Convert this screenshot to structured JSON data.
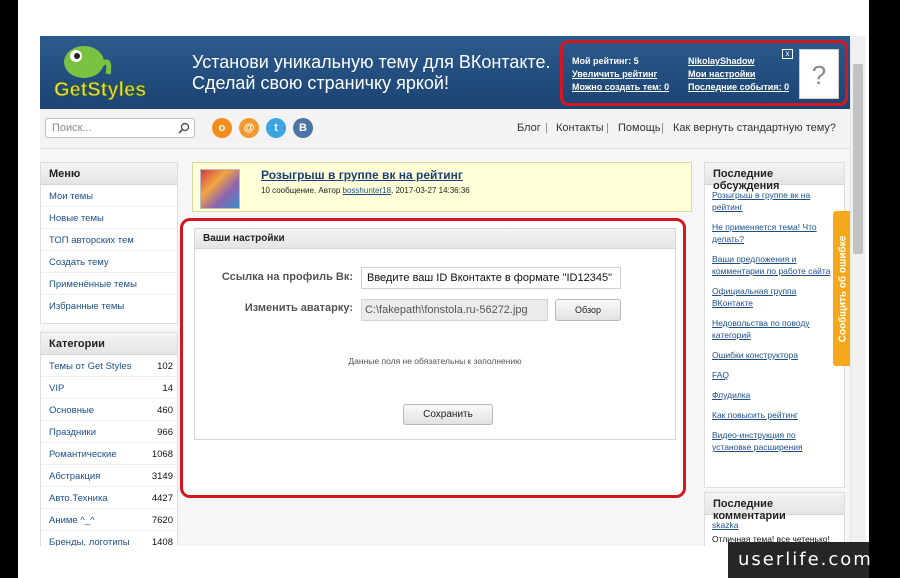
{
  "header": {
    "logo_text": "GetStyles",
    "slogan_line1": "Установи уникальную тему для ВКонтакте.",
    "slogan_line2": "Сделай свою страничку яркой!",
    "rating": "Мой рейтинг: 5",
    "increase_rating": "Увеличить рейтинг",
    "can_create": "Можно создать тем: 0",
    "username": "NikolayShadow",
    "my_settings": "Мои настройки",
    "recent_events": "Последние события: 0",
    "close": "[x]",
    "avatar_placeholder": "?"
  },
  "toolbar": {
    "search_placeholder": "Поиск...",
    "social": [
      "ok-icon",
      "mail-icon",
      "twitter-icon",
      "vk-icon"
    ],
    "nav": [
      "Блог",
      "Контакты",
      "Помощь",
      "Как вернуть стандартную тему?"
    ]
  },
  "menu": {
    "title": "Меню",
    "items": [
      "Мои темы",
      "Новые темы",
      "ТОП авторских тем",
      "Создать тему",
      "Применённые темы",
      "Избранные темы"
    ]
  },
  "categories": {
    "title": "Категории",
    "items": [
      {
        "label": "Темы от Get Styles",
        "count": "102"
      },
      {
        "label": "VIP",
        "count": "14"
      },
      {
        "label": "Основные",
        "count": "460"
      },
      {
        "label": "Праздники",
        "count": "966"
      },
      {
        "label": "Романтические",
        "count": "1068"
      },
      {
        "label": "Абстракция",
        "count": "3149"
      },
      {
        "label": "Авто.Техника",
        "count": "4427"
      },
      {
        "label": "Аниме ^_^",
        "count": "7620"
      },
      {
        "label": "Бренды, логотипы",
        "count": "1408"
      }
    ]
  },
  "contest": {
    "title": "Розыгрыш в группе вк на рейтинг",
    "meta_prefix": "10 сообщение. Автор",
    "author": "bosshunter18",
    "date": "2017-03-27 14:36:36"
  },
  "settings": {
    "title": "Ваши настройки",
    "vk_label": "Ссылка на профиль Вк:",
    "vk_value": "Введите ваш ID Вконтакте в формате \"ID12345\"",
    "avatar_label": "Изменить аватарку:",
    "file_value": "C:\\fakepath\\fonstola.ru-56272.jpg",
    "browse": "Обзор",
    "hint": "Данные поля не обязательны к заполнению",
    "save": "Сохранить"
  },
  "discussions": {
    "title": "Последние обсуждения",
    "items": [
      "Розыгрыш в группе вк на рейтинг",
      "Не применяется тема! Что делать?",
      "Ваши предложения и комментарии по работе сайта",
      "Официальная группа ВКонтакте",
      "Недовольства по поводу категорий",
      "Ошибки конструктора",
      "FAQ",
      "Флудилка",
      "Как повысить рейтинг",
      "Видео-инструкция по установке расширения"
    ]
  },
  "comments": {
    "title": "Последние комментарии",
    "user": "skazka",
    "text": "Отличная тема! все четенько!"
  },
  "feedback": "Сообщить об ошибке",
  "watermark": "userlife.com",
  "colors": {
    "header": "#2b5b8c",
    "highlight": "#d4161f",
    "feedback": "#f4a81a",
    "link": "#1d4f8a"
  }
}
